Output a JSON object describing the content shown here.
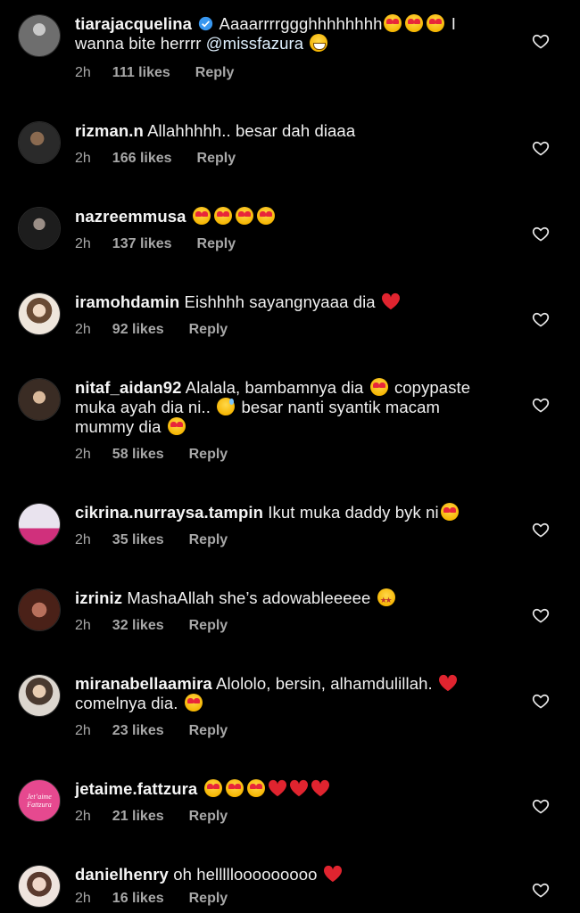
{
  "ui": {
    "reply_label": "Reply"
  },
  "comments": [
    {
      "username": "tiarajacquelina",
      "verified": true,
      "text": "Aaaarrrrggghhhhhhhh",
      "emoji_after": [
        "heart-eyes",
        "heart-eyes",
        "heart-eyes"
      ],
      "text2": " I wanna bite herrrr ",
      "mention": "@missfazura",
      "emoji_end": [
        "grin"
      ],
      "time": "2h",
      "likes": "111 likes",
      "avatar_color": "#8a8a8a"
    },
    {
      "username": "rizman.n",
      "text": "Allahhhhh.. besar dah diaaa",
      "time": "2h",
      "likes": "166 likes",
      "avatar_color": "#3a3a3a"
    },
    {
      "username": "nazreemmusa",
      "text": "",
      "emoji_after": [
        "heart-eyes",
        "heart-eyes",
        "heart-eyes",
        "heart-eyes"
      ],
      "time": "2h",
      "likes": "137 likes",
      "avatar_color": "#2b2b2b"
    },
    {
      "username": "iramohdamin",
      "text": "Eishhhh sayangnyaaa dia",
      "hearts": 1,
      "time": "2h",
      "likes": "92 likes",
      "avatar_color": "#d8c9b8"
    },
    {
      "username": "nitaf_aidan92",
      "text": "Alalala, bambamnya dia",
      "line2": "copypaste muka ayah dia ni..",
      "line3": "besar nanti syantik macam mummy dia",
      "time": "2h",
      "likes": "58 likes",
      "avatar_color": "#5a4a3e"
    },
    {
      "username": "cikrina.nurraysa.tampin",
      "text": "Ikut muka daddy byk ni",
      "emoji_end": [
        "heart-eyes"
      ],
      "time": "2h",
      "likes": "35 likes",
      "avatar_color": "#cfc6d9"
    },
    {
      "username": "izriniz",
      "text": "MashaAllah she’s adowableeeee",
      "emoji_end": [
        "star-struck"
      ],
      "time": "2h",
      "likes": "32 likes",
      "avatar_color": "#7a3b2e"
    },
    {
      "username": "miranabellaamira",
      "text": "Alololo, bersin, alhamdulillah.",
      "line2": "comelnya dia.",
      "time": "2h",
      "likes": "23 likes",
      "avatar_color": "#b9a68f"
    },
    {
      "username": "jetaime.fattzura",
      "text": "",
      "emoji_after": [
        "heart-eyes",
        "heart-eyes",
        "heart-eyes"
      ],
      "hearts": 3,
      "avatar_text": "Jet’aime Fattzura",
      "time": "2h",
      "likes": "21 likes",
      "avatar_color": "#e6498f"
    },
    {
      "username": "danielhenry",
      "text": "oh helllllooooooooo",
      "hearts": 1,
      "time": "2h",
      "likes": "16 likes",
      "avatar_color": "#d9c9c0"
    }
  ]
}
